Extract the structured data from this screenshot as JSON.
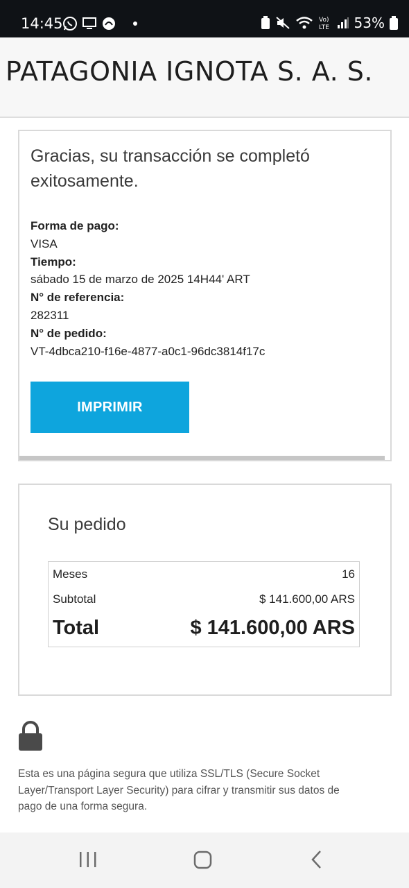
{
  "status_bar": {
    "time": "14:45",
    "battery_percent": "53%",
    "icons_left": [
      "whatsapp-icon",
      "screen-icon",
      "app-icon",
      "notification-dot"
    ],
    "icons_right": [
      "battery-saver-icon",
      "mute-icon",
      "wifi-icon",
      "volte-icon",
      "signal-icon",
      "battery-icon"
    ]
  },
  "header": {
    "title": "PATAGONIA IGNOTA S. A. S."
  },
  "confirmation": {
    "message": "Gracias, su transacción se completó exitosamente.",
    "payment_method_label": "Forma de pago:",
    "payment_method_value": "VISA",
    "time_label": "Tiempo:",
    "time_value": "sábado 15 de marzo de 2025 14H44' ART",
    "reference_label": "N° de referencia:",
    "reference_value": "282311",
    "order_label": "N° de pedido:",
    "order_value": "VT-4dbca210-f16e-4877-a0c1-96dc3814f17c",
    "print_button": "IMPRIMIR"
  },
  "order": {
    "title": "Su pedido",
    "rows": [
      {
        "label": "Meses",
        "value": "16"
      },
      {
        "label": "Subtotal",
        "value": "$ 141.600,00 ARS"
      },
      {
        "label": "Total",
        "value": "$ 141.600,00 ARS"
      }
    ]
  },
  "secure": {
    "icon": "lock-icon",
    "text": "Esta es una página segura que utiliza SSL/TLS (Secure Socket Layer/Transport Layer Security) para cifrar y transmitir sus datos de pago de una forma segura."
  },
  "nav": {
    "buttons": [
      "recents-icon",
      "home-icon",
      "back-icon"
    ]
  },
  "colors": {
    "accent": "#0ea5dd",
    "status_bar_bg": "#0f1216"
  }
}
